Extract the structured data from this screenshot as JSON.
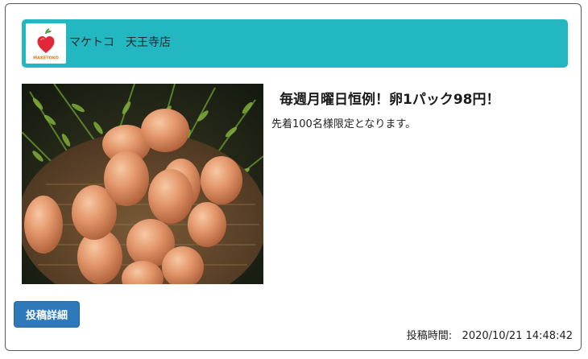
{
  "store": {
    "name": "マケトコ　天王寺店",
    "logo_text": "MAKETOKO",
    "logo_icon": "apple-heart-icon",
    "brand_color": "#23b7c2"
  },
  "post": {
    "title": "毎週月曜日恒例！卵1パック98円！",
    "body": "先着100名様限定となります。",
    "image": "eggs-in-basket-photo"
  },
  "actions": {
    "detail_label": "投稿詳細",
    "button_color": "#2f79ba"
  },
  "meta": {
    "posted_label": "投稿時間:",
    "posted_time": "2020/10/21 14:48:42"
  }
}
